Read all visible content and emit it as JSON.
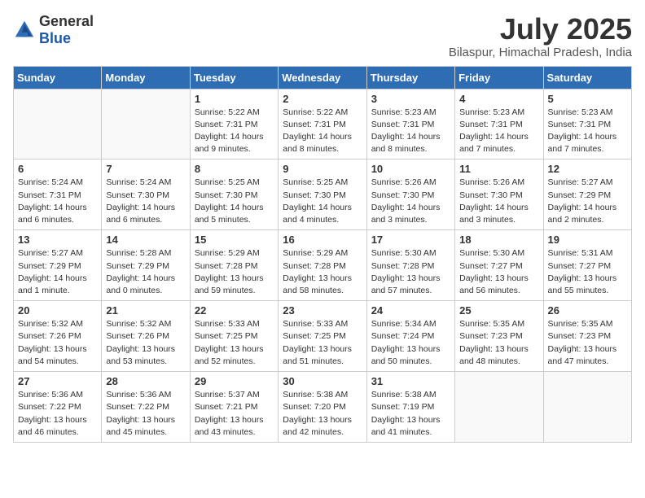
{
  "header": {
    "logo_general": "General",
    "logo_blue": "Blue",
    "month_title": "July 2025",
    "location": "Bilaspur, Himachal Pradesh, India"
  },
  "weekdays": [
    "Sunday",
    "Monday",
    "Tuesday",
    "Wednesday",
    "Thursday",
    "Friday",
    "Saturday"
  ],
  "weeks": [
    [
      {
        "day": "",
        "info": ""
      },
      {
        "day": "",
        "info": ""
      },
      {
        "day": "1",
        "info": "Sunrise: 5:22 AM\nSunset: 7:31 PM\nDaylight: 14 hours and 9 minutes."
      },
      {
        "day": "2",
        "info": "Sunrise: 5:22 AM\nSunset: 7:31 PM\nDaylight: 14 hours and 8 minutes."
      },
      {
        "day": "3",
        "info": "Sunrise: 5:23 AM\nSunset: 7:31 PM\nDaylight: 14 hours and 8 minutes."
      },
      {
        "day": "4",
        "info": "Sunrise: 5:23 AM\nSunset: 7:31 PM\nDaylight: 14 hours and 7 minutes."
      },
      {
        "day": "5",
        "info": "Sunrise: 5:23 AM\nSunset: 7:31 PM\nDaylight: 14 hours and 7 minutes."
      }
    ],
    [
      {
        "day": "6",
        "info": "Sunrise: 5:24 AM\nSunset: 7:31 PM\nDaylight: 14 hours and 6 minutes."
      },
      {
        "day": "7",
        "info": "Sunrise: 5:24 AM\nSunset: 7:30 PM\nDaylight: 14 hours and 6 minutes."
      },
      {
        "day": "8",
        "info": "Sunrise: 5:25 AM\nSunset: 7:30 PM\nDaylight: 14 hours and 5 minutes."
      },
      {
        "day": "9",
        "info": "Sunrise: 5:25 AM\nSunset: 7:30 PM\nDaylight: 14 hours and 4 minutes."
      },
      {
        "day": "10",
        "info": "Sunrise: 5:26 AM\nSunset: 7:30 PM\nDaylight: 14 hours and 3 minutes."
      },
      {
        "day": "11",
        "info": "Sunrise: 5:26 AM\nSunset: 7:30 PM\nDaylight: 14 hours and 3 minutes."
      },
      {
        "day": "12",
        "info": "Sunrise: 5:27 AM\nSunset: 7:29 PM\nDaylight: 14 hours and 2 minutes."
      }
    ],
    [
      {
        "day": "13",
        "info": "Sunrise: 5:27 AM\nSunset: 7:29 PM\nDaylight: 14 hours and 1 minute."
      },
      {
        "day": "14",
        "info": "Sunrise: 5:28 AM\nSunset: 7:29 PM\nDaylight: 14 hours and 0 minutes."
      },
      {
        "day": "15",
        "info": "Sunrise: 5:29 AM\nSunset: 7:28 PM\nDaylight: 13 hours and 59 minutes."
      },
      {
        "day": "16",
        "info": "Sunrise: 5:29 AM\nSunset: 7:28 PM\nDaylight: 13 hours and 58 minutes."
      },
      {
        "day": "17",
        "info": "Sunrise: 5:30 AM\nSunset: 7:28 PM\nDaylight: 13 hours and 57 minutes."
      },
      {
        "day": "18",
        "info": "Sunrise: 5:30 AM\nSunset: 7:27 PM\nDaylight: 13 hours and 56 minutes."
      },
      {
        "day": "19",
        "info": "Sunrise: 5:31 AM\nSunset: 7:27 PM\nDaylight: 13 hours and 55 minutes."
      }
    ],
    [
      {
        "day": "20",
        "info": "Sunrise: 5:32 AM\nSunset: 7:26 PM\nDaylight: 13 hours and 54 minutes."
      },
      {
        "day": "21",
        "info": "Sunrise: 5:32 AM\nSunset: 7:26 PM\nDaylight: 13 hours and 53 minutes."
      },
      {
        "day": "22",
        "info": "Sunrise: 5:33 AM\nSunset: 7:25 PM\nDaylight: 13 hours and 52 minutes."
      },
      {
        "day": "23",
        "info": "Sunrise: 5:33 AM\nSunset: 7:25 PM\nDaylight: 13 hours and 51 minutes."
      },
      {
        "day": "24",
        "info": "Sunrise: 5:34 AM\nSunset: 7:24 PM\nDaylight: 13 hours and 50 minutes."
      },
      {
        "day": "25",
        "info": "Sunrise: 5:35 AM\nSunset: 7:23 PM\nDaylight: 13 hours and 48 minutes."
      },
      {
        "day": "26",
        "info": "Sunrise: 5:35 AM\nSunset: 7:23 PM\nDaylight: 13 hours and 47 minutes."
      }
    ],
    [
      {
        "day": "27",
        "info": "Sunrise: 5:36 AM\nSunset: 7:22 PM\nDaylight: 13 hours and 46 minutes."
      },
      {
        "day": "28",
        "info": "Sunrise: 5:36 AM\nSunset: 7:22 PM\nDaylight: 13 hours and 45 minutes."
      },
      {
        "day": "29",
        "info": "Sunrise: 5:37 AM\nSunset: 7:21 PM\nDaylight: 13 hours and 43 minutes."
      },
      {
        "day": "30",
        "info": "Sunrise: 5:38 AM\nSunset: 7:20 PM\nDaylight: 13 hours and 42 minutes."
      },
      {
        "day": "31",
        "info": "Sunrise: 5:38 AM\nSunset: 7:19 PM\nDaylight: 13 hours and 41 minutes."
      },
      {
        "day": "",
        "info": ""
      },
      {
        "day": "",
        "info": ""
      }
    ]
  ]
}
